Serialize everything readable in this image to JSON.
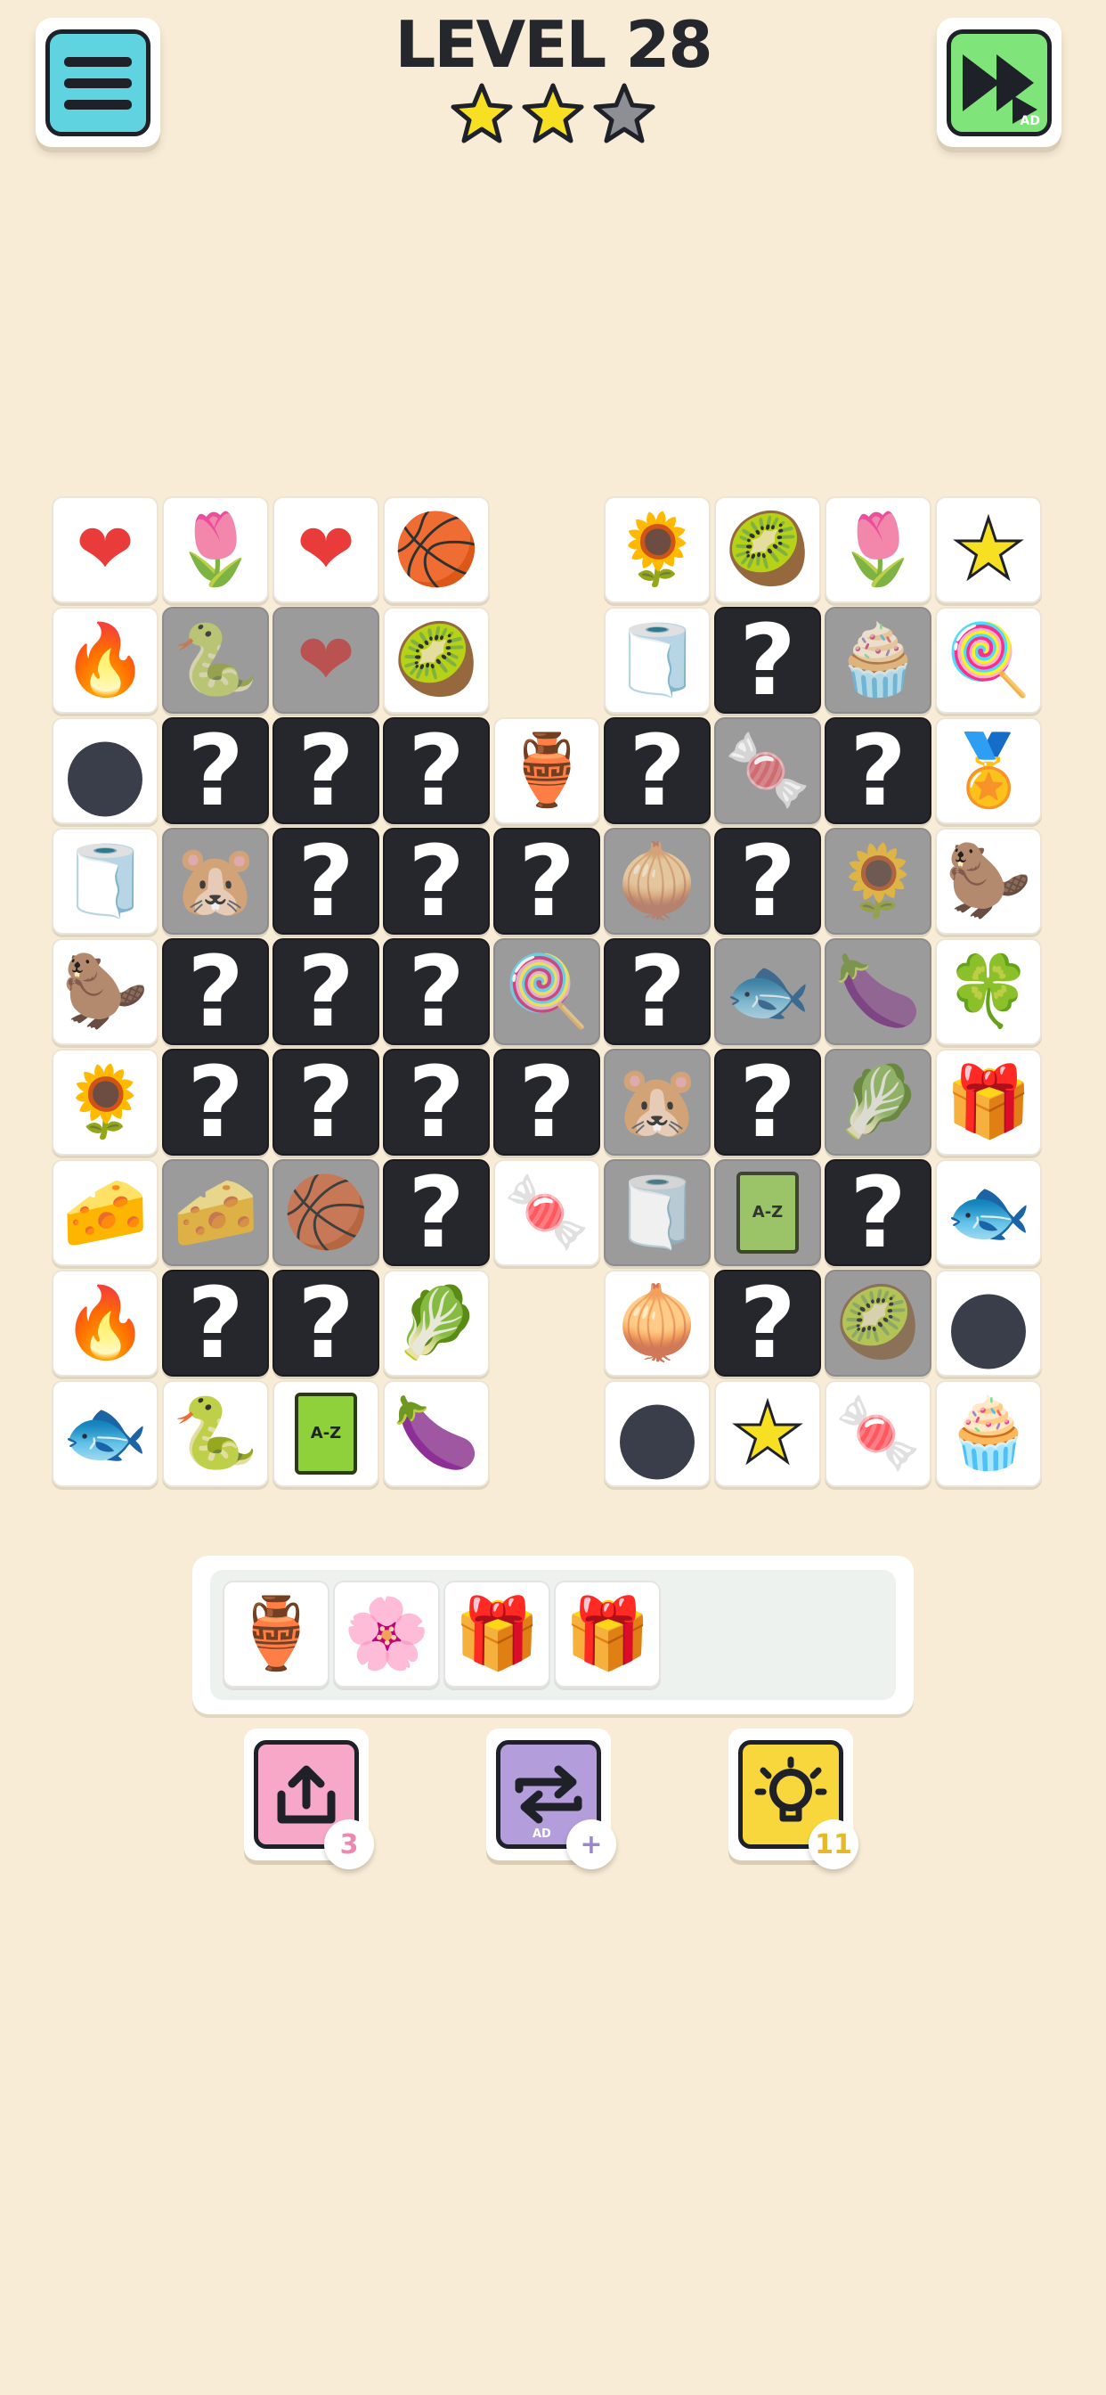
{
  "header": {
    "level_title": "LEVEL 28",
    "stars_earned": 2,
    "stars_total": 3,
    "menu_icon": "hamburger-menu-icon",
    "skip_icon": "fast-forward-ad-icon",
    "skip_ad_label": "AD"
  },
  "board": {
    "rows": [
      [
        "heart",
        "tulip",
        "heart",
        "basketball",
        null,
        "sunflower",
        "kiwi",
        "tulip",
        "star"
      ],
      [
        "fire",
        "snake*",
        "heart*",
        "kiwi",
        null,
        "toilet-paper",
        "?",
        "cupcake*",
        "popsicle"
      ],
      [
        "bowling-ball",
        "?",
        "?",
        "?",
        "jug",
        "?",
        "candy*",
        "?",
        "medal"
      ],
      [
        "toilet-paper",
        "hamster*",
        "?",
        "?",
        "?",
        "onion*",
        "?",
        "sunflower*",
        "beaver"
      ],
      [
        "beaver",
        "?",
        "?",
        "?",
        "popsicle*",
        "?",
        "fish*",
        "eggplant*",
        "clover"
      ],
      [
        "sunflower",
        "?",
        "?",
        "?",
        "?",
        "hamster*",
        "?",
        "cabbage*",
        "gift"
      ],
      [
        "cheese",
        "cheese*",
        "basketball*",
        "?",
        "candy",
        "toilet-paper*",
        "dictionary*",
        "?",
        "fish"
      ],
      [
        "fire",
        "?",
        "?",
        "cabbage",
        null,
        "onion",
        "?",
        "kiwi*",
        "bowling-ball"
      ],
      [
        "fish",
        "snake",
        "dictionary",
        "eggplant",
        null,
        "bowling-ball",
        "star",
        "candy",
        "cupcake"
      ]
    ],
    "legend": {
      "?": "hidden tile (question mark)",
      "*": "blocked tile (greyed out)"
    },
    "hidden_mark": "?"
  },
  "tray": {
    "slots": [
      "jug",
      "blossom",
      "gift",
      "gift"
    ],
    "capacity": 7
  },
  "powerups": [
    {
      "name": "undo",
      "icon": "share-up-arrow-icon",
      "count": "3",
      "color": "#f7a8c8",
      "badge_color": "#e98bb0"
    },
    {
      "name": "shuffle",
      "icon": "shuffle-arrows-icon",
      "count": "+",
      "color": "#b39ddb",
      "badge_color": "#9c88c9",
      "ad_label": "AD"
    },
    {
      "name": "hint",
      "icon": "lightbulb-icon",
      "count": "11",
      "color": "#f8d73c",
      "badge_color": "#e6b92c"
    }
  ],
  "icons": {
    "heart": "❤",
    "tulip": "🌷",
    "basketball": "🏀",
    "sunflower": "🌻",
    "kiwi": "🥝",
    "star": "★",
    "fire": "🔥",
    "snake": "🐍",
    "toilet-paper": "🧻",
    "cupcake": "🧁",
    "popsicle": "🍭",
    "bowling-ball": "●",
    "jug": "🏺",
    "candy": "🍬",
    "medal": "🏅",
    "hamster": "🐹",
    "onion": "🧅",
    "beaver": "🦫",
    "fish": "🐟",
    "eggplant": "🍆",
    "clover": "🍀",
    "cabbage": "🥬",
    "gift": "🎁",
    "cheese": "🧀",
    "dictionary": "A-Z",
    "blossom": "🌸"
  },
  "colors": {
    "background": "#f8ecd6",
    "hidden_tile": "#25272c",
    "blocked_tile": "#9b9b9b",
    "free_tile": "#ffffff",
    "menu_button": "#5fd3e0",
    "skip_button": "#7fe57a",
    "star_gold": "#f6e021",
    "star_grey": "#8d8f94"
  }
}
